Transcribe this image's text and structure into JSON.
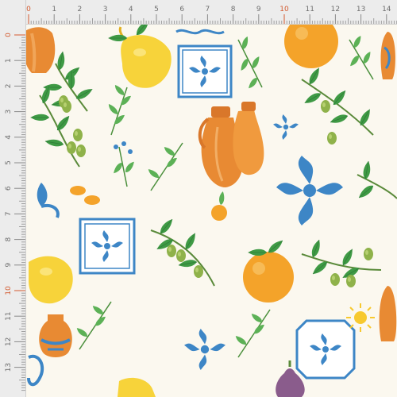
{
  "ruler": {
    "unit_labels_top": [
      "0",
      "1",
      "2",
      "3",
      "4",
      "5",
      "6",
      "7",
      "8",
      "9",
      "10",
      "11",
      "12",
      "13",
      "14"
    ],
    "unit_labels_left": [
      "0",
      "1",
      "2",
      "3",
      "4",
      "5",
      "6",
      "7",
      "8",
      "9",
      "10",
      "11",
      "12",
      "13"
    ],
    "highlight_color": "#d35a2f"
  },
  "pattern": {
    "background_color": "#fbf8ef",
    "motifs": [
      "orange",
      "lemon",
      "olive-branch",
      "herb-sprig",
      "terracotta-jug",
      "amphora-vase",
      "blue-tile",
      "blue-flourish",
      "sun",
      "fig"
    ],
    "palette": {
      "orange": "#f4a32a",
      "lemon": "#f7d33a",
      "terracotta": "#e88a33",
      "leaf": "#3f9a45",
      "olive": "#8fb24a",
      "tile_blue": "#3d86c6",
      "fig": "#8a5c8c"
    }
  }
}
